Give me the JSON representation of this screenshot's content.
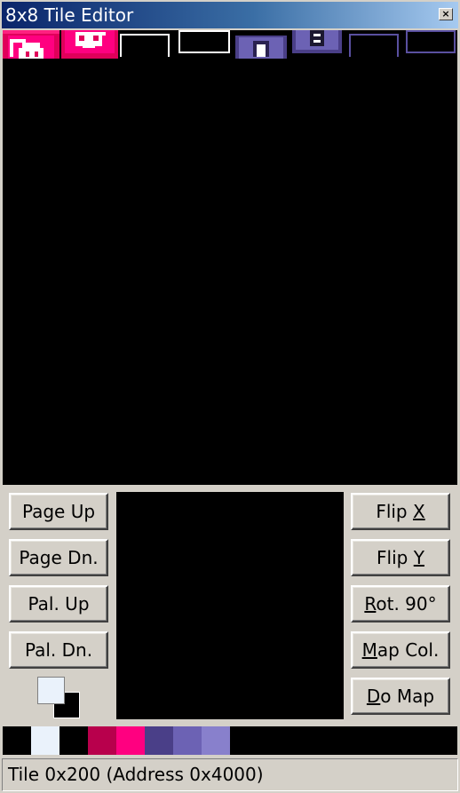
{
  "window": {
    "title": "8x8 Tile Editor",
    "close_symbol": "×"
  },
  "buttons": {
    "page_up": "Page Up",
    "page_down": "Page Dn.",
    "pal_up": "Pal. Up",
    "pal_down": "Pal. Dn.",
    "flip_x": {
      "prefix": "Flip ",
      "key": "X",
      "suffix": ""
    },
    "flip_y": {
      "prefix": "Flip ",
      "key": "Y",
      "suffix": ""
    },
    "rotate": {
      "prefix": "",
      "key": "R",
      "suffix": "ot. 90°"
    },
    "map_col": {
      "prefix": "",
      "key": "M",
      "suffix": "ap Col."
    },
    "do_map": {
      "prefix": "",
      "key": "D",
      "suffix": "o Map"
    }
  },
  "current_colors": {
    "foreground": "#eaf2fb",
    "background": "#000000"
  },
  "palette": [
    "#000000",
    "#eaf2fb",
    "#000000",
    "#b8004c",
    "#ff0080",
    "#4a3f88",
    "#6c62b4",
    "#8880cc"
  ],
  "status": {
    "text": "Tile 0x200 (Address 0x4000)"
  }
}
